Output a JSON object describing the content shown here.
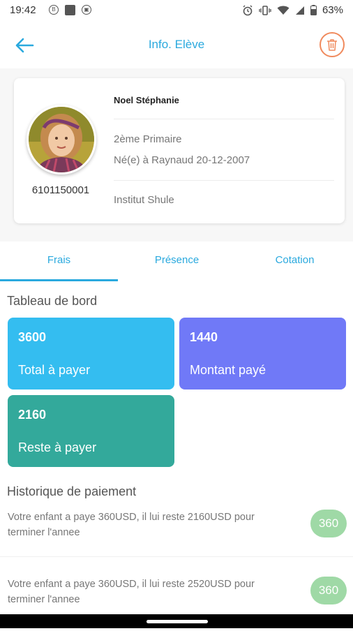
{
  "status_bar": {
    "time": "19:42",
    "battery": "63%",
    "left_icons": [
      "b-circle-icon",
      "square-notification-icon",
      "lock-circle-icon"
    ],
    "right_icons": [
      "alarm-icon",
      "vibrate-icon",
      "wifi-icon",
      "signal-icon",
      "battery-icon"
    ]
  },
  "header": {
    "title": "Info. Elève",
    "back_icon": "arrow-left-icon",
    "delete_icon": "trash-icon"
  },
  "student": {
    "name": "Noel Stéphanie",
    "matricule": "6101150001",
    "class": "2ème Primaire",
    "birth": "Né(e) à Raynaud 20-12-2007",
    "school": "Institut Shule"
  },
  "tabs": [
    {
      "label": "Frais",
      "active": true
    },
    {
      "label": "Présence",
      "active": false
    },
    {
      "label": "Cotation",
      "active": false
    }
  ],
  "dashboard": {
    "title": "Tableau de bord",
    "tiles": [
      {
        "value": "3600",
        "label": "Total à payer",
        "color": "#34bdf0"
      },
      {
        "value": "1440",
        "label": "Montant payé",
        "color": "#7079f7"
      },
      {
        "value": "2160",
        "label": "Reste à payer",
        "color": "#33a99b"
      }
    ]
  },
  "history": {
    "title": "Historique de paiement",
    "items": [
      {
        "text": "Votre enfant a paye 360USD, il lui reste 2160USD pour terminer l'annee",
        "amount": "360"
      },
      {
        "text": "Votre enfant a paye 360USD, il lui reste 2520USD pour terminer l'annee",
        "amount": "360"
      }
    ]
  },
  "colors": {
    "accent": "#2aa9de",
    "delete": "#f08a5d",
    "badge": "#9fd9a6"
  }
}
